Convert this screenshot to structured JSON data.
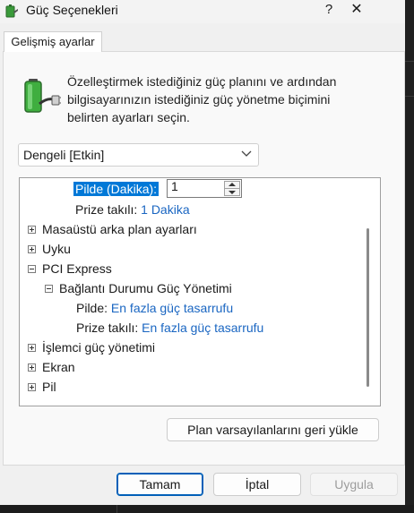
{
  "window": {
    "title": "Güç Seçenekleri",
    "help": "?",
    "close": "✕"
  },
  "tab": {
    "label": "Gelişmiş ayarlar"
  },
  "intro": "Özelleştirmek istediğiniz güç planını ve ardından bilgisayarınızın istediğiniz güç yönetme biçimini belirten ayarları seçin.",
  "plan_select": {
    "value": "Dengeli [Etkin]"
  },
  "tree": {
    "row_onbattery_label": "Pilde (Dakika):",
    "row_onbattery_value": "1",
    "row_pluggedin_label": "Prize takılı:",
    "row_pluggedin_value": "1 Dakika",
    "desktop_bg": "Masaüstü arka plan ayarları",
    "sleep": "Uyku",
    "pci": "PCI Express",
    "link_state": "Bağlantı Durumu Güç Yönetimi",
    "ls_battery_label": "Pilde:",
    "ls_battery_value": "En fazla güç tasarrufu",
    "ls_plugged_label": "Prize takılı:",
    "ls_plugged_value": "En fazla güç tasarrufu",
    "processor": "İşlemci güç yönetimi",
    "display": "Ekran",
    "battery": "Pil"
  },
  "buttons": {
    "restore_defaults": "Plan varsayılanlarını geri yükle",
    "ok": "Tamam",
    "cancel": "İptal",
    "apply": "Uygula"
  },
  "colors": {
    "accent": "#0078d7",
    "link": "#1a66c2",
    "default_border": "#005fb8"
  }
}
